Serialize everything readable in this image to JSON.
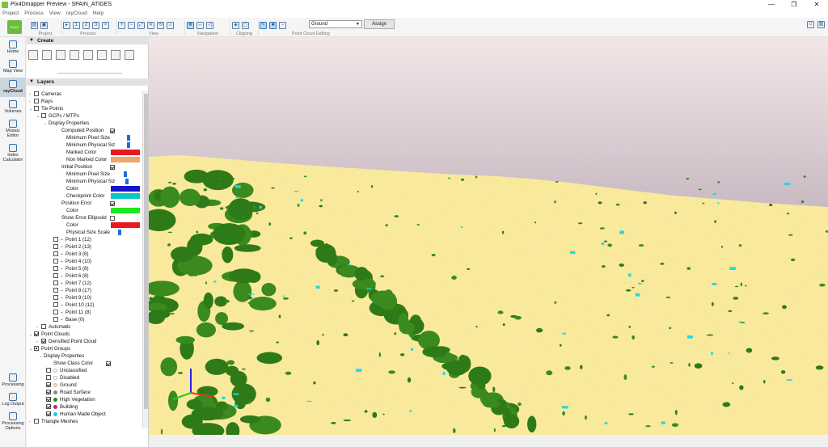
{
  "window": {
    "title": "Pix4Dmapper Preview - SPAIN_ATIGES",
    "minimize": "—",
    "maximize": "❐",
    "close": "✕"
  },
  "menu": [
    "Project",
    "Process",
    "View",
    "rayCloud",
    "Help"
  ],
  "toolbar": {
    "groups": [
      "Project",
      "Process",
      "View",
      "Navigation",
      "Clipping",
      "Point Cloud Editing"
    ],
    "class_select": "Ground",
    "assign_label": "Assign"
  },
  "sidebar": {
    "logo": "Pix4D",
    "items": [
      "Home",
      "Map View",
      "rayCloud",
      "Volumes",
      "Mosaic Editor",
      "Index Calculator",
      "Processing",
      "Log Output",
      "Processing Options"
    ]
  },
  "panel": {
    "create_header": "Create",
    "layers_header": "Layers",
    "tree": [
      "Cameras",
      "Rays",
      "Tie Points",
      "GCPs / MTPs",
      "Display Properties",
      "Computed Position",
      "Minimum Pixel Size",
      "Minimum Physical Siz",
      "Marked Color",
      "Non Marked Color",
      "Initial Position",
      "Minimum Pixel Size",
      "Minimum Physical Siz",
      "Color",
      "Checkpoint Color",
      "Position Error",
      "Color",
      "Show Error Ellipsoid",
      "Color",
      "Physical Size Scale",
      "Point 1 (12)",
      "Point 2 (13)",
      "Point 3 (8)",
      "Point 4 (10)",
      "Point 5 (8)",
      "Point 6 (8)",
      "Point 7 (12)",
      "Point 8 (17)",
      "Point 9 (10)",
      "Point 10 (12)",
      "Point 11 (8)",
      "Base (0)",
      "Automatic",
      "Point Clouds",
      "Densified Point Cloud",
      "Point Groups",
      "Display Properties",
      "Show Class Color",
      "Unclassified",
      "Disabled",
      "Ground",
      "Road Surface",
      "High Vegetation",
      "Building",
      "Human Made Object",
      "Triangle Meshes"
    ],
    "colors": {
      "marked": "#e8191f",
      "non_marked": "#f0a56a",
      "initial": "#1414c8",
      "checkpoint": "#0bc4c8",
      "pos_error": "#1ee81e",
      "ellipsoid": "#e8191f",
      "unclassified": "#ffffff",
      "disabled": "#ffffff",
      "ground": "#f5e89a",
      "road": "#8a8a8a",
      "high_veg": "#2a8a20",
      "building": "#d0148c",
      "human_made": "#19c8e6"
    },
    "sliders": {
      "computed_min_pixel": 0.55,
      "computed_min_phys": 0.55,
      "initial_min_pixel": 0.45,
      "initial_min_phys": 0.5,
      "physical_size_scale": 0.25
    }
  },
  "view": {
    "sky_top": "#f3e6e6",
    "sky_bottom": "#8888a4",
    "ground": "#fbeb9d",
    "vegetation": "#3b8a1e",
    "water_cyan": "#22d8e8"
  }
}
